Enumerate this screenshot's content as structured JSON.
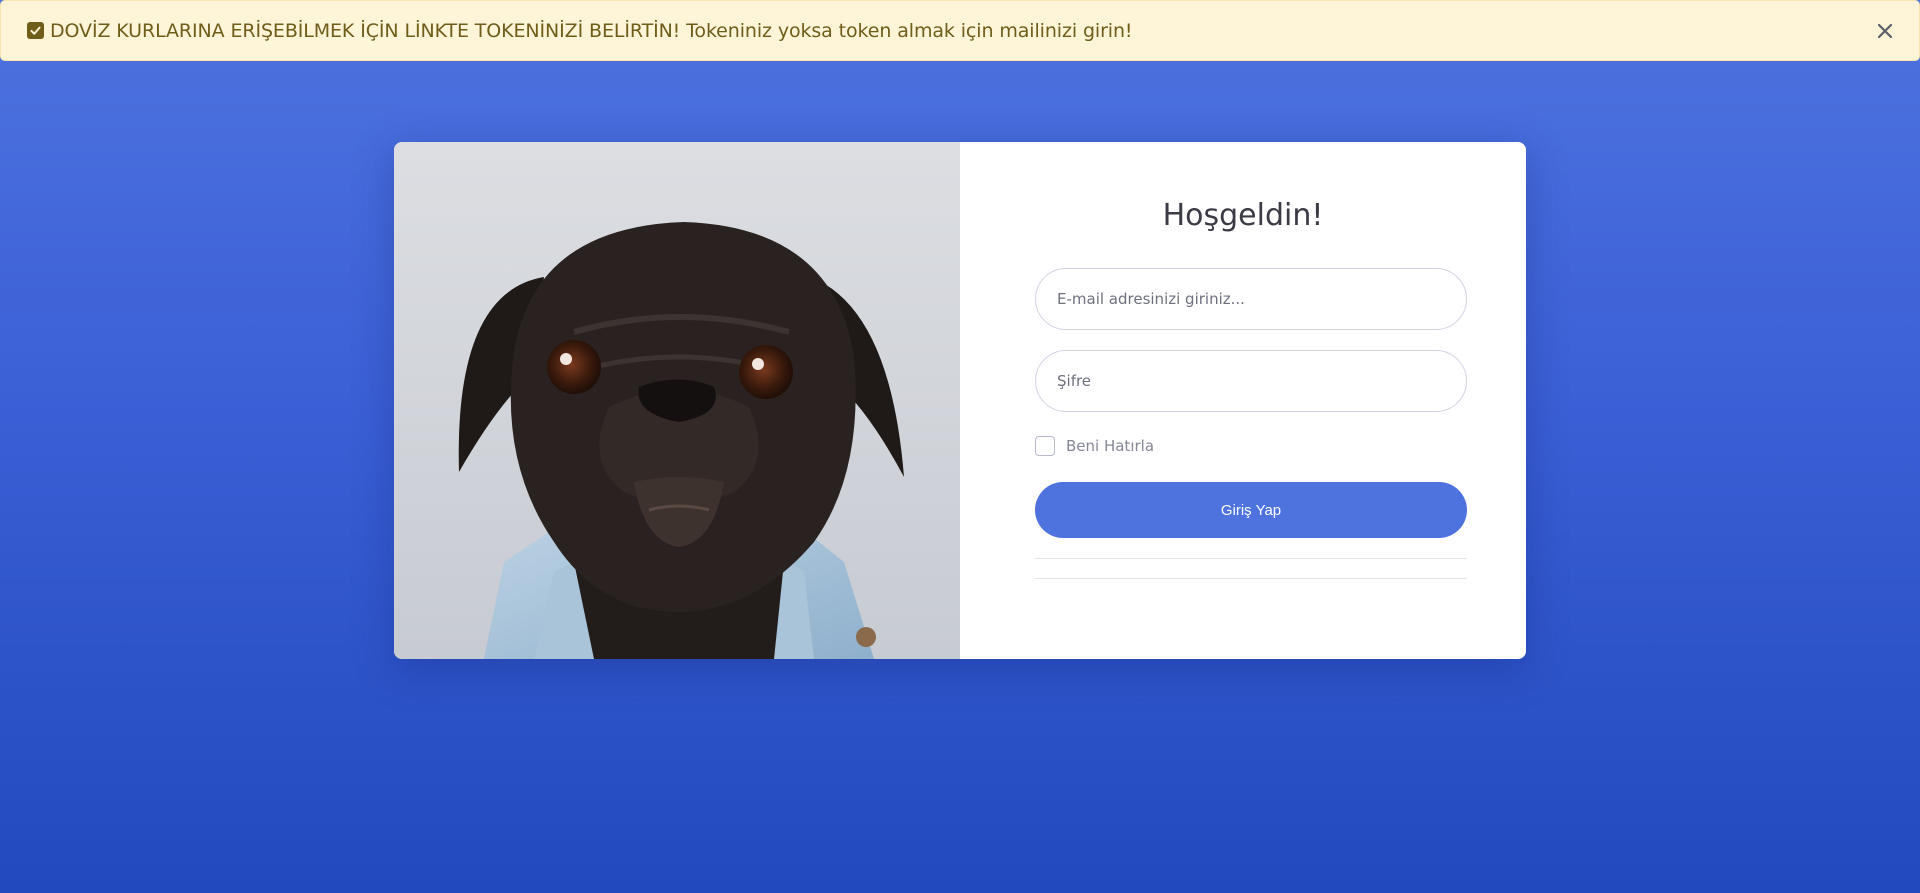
{
  "alert": {
    "message": "DOVİZ KURLARINA ERİŞEBİLMEK İÇİN LİNKTE TOKENİNİZİ BELİRTİN! Tokeniniz yoksa token almak için mailinizi girin!",
    "icon": "check-square-icon",
    "close_icon": "close-icon"
  },
  "login": {
    "title": "Hoşgeldin!",
    "email_placeholder": "E-mail adresinizi giriniz...",
    "email_value": "",
    "password_placeholder": "Şifre",
    "password_value": "",
    "remember_label": "Beni Hatırla",
    "remember_checked": false,
    "submit_label": "Giriş Yap"
  },
  "colors": {
    "primary": "#4e73df",
    "background_gradient_start": "#4e73df",
    "background_gradient_end": "#224abe",
    "alert_background": "#fef5d9",
    "alert_text": "#705d19"
  }
}
